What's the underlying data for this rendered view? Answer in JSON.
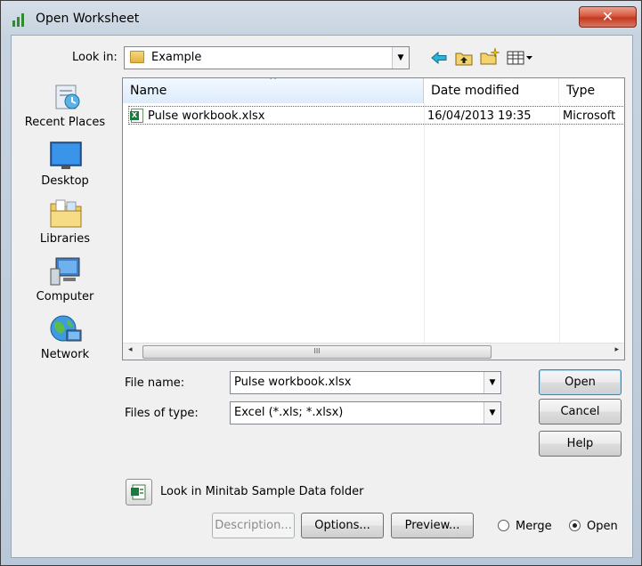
{
  "window": {
    "title": "Open Worksheet",
    "close_glyph": "✕"
  },
  "lookin": {
    "label": "Look in:",
    "value": "Example",
    "arrow": "▼"
  },
  "toolbar": {
    "icons": [
      "back-icon",
      "up-folder-icon",
      "new-folder-icon",
      "view-menu-icon"
    ]
  },
  "places": [
    {
      "label": "Recent Places",
      "icon": "recent-places-icon"
    },
    {
      "label": "Desktop",
      "icon": "desktop-icon"
    },
    {
      "label": "Libraries",
      "icon": "libraries-icon"
    },
    {
      "label": "Computer",
      "icon": "computer-icon"
    },
    {
      "label": "Network",
      "icon": "network-icon"
    }
  ],
  "filelist": {
    "columns": [
      "Name",
      "Date modified",
      "Type"
    ],
    "rows": [
      {
        "name": "Pulse workbook.xlsx",
        "date": "16/04/2013 19:35",
        "type": "Microsoft"
      }
    ],
    "scroll_grip": "III",
    "scroll_left": "◂",
    "scroll_right": "▸",
    "sort_arrow": "^"
  },
  "filename": {
    "label": "File name:",
    "value": "Pulse workbook.xlsx"
  },
  "filetype": {
    "label": "Files of type:",
    "value": "Excel (*.xls; *.xlsx)"
  },
  "buttons": {
    "open": "Open",
    "cancel": "Cancel",
    "help": "Help",
    "description": "Description...",
    "options": "Options...",
    "preview": "Preview..."
  },
  "sample_folder": {
    "label": "Look in Minitab Sample Data folder"
  },
  "mode": {
    "merge": "Merge",
    "open": "Open",
    "selected": "open"
  },
  "colors": {
    "accent": "#3c7fb1",
    "close": "#c0391f",
    "title_bg": "#c7d3e0"
  }
}
